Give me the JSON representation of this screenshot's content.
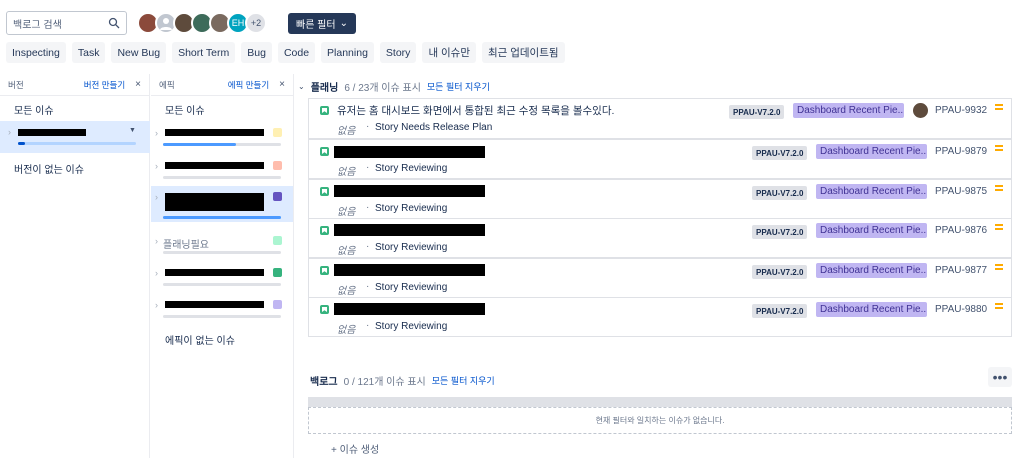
{
  "search": {
    "placeholder": "백로그 검색"
  },
  "avatars": {
    "initials": "EH",
    "overflow": "+2"
  },
  "quick_filter": {
    "label": "빠른 필터"
  },
  "filter_chips": [
    "Inspecting",
    "Task",
    "New Bug",
    "Short Term",
    "Bug",
    "Code",
    "Planning",
    "Story",
    "내 이슈만",
    "최근 업데이트됨"
  ],
  "versions": {
    "title": "버전",
    "create": "버전 만들기",
    "close": "×",
    "all": "모든 이슈",
    "no_version": "버전이 없는 이슈"
  },
  "epics": {
    "title": "에픽",
    "create": "에픽 만들기",
    "close": "×",
    "all": "모든 이슈",
    "planning_needed": "플래닝필요",
    "no_epic": "에픽이 없는 이슈",
    "colors": [
      "#fff0b3",
      "#ffbdad",
      "#6554c0",
      "#abf5d1",
      "#36b37e",
      "#c0b6f2"
    ]
  },
  "sprint": {
    "name": "플래닝",
    "count": "6 / 23개 이슈 표시",
    "clear": "모든 필터 지우기",
    "issues": [
      {
        "title": "유저는 홈 대시보드 화면에서 통합된 최근 수정 목록을 볼수있다.",
        "none": "없음",
        "status": "Story Needs Release Plan",
        "version": "PPAU-V7.2.0",
        "epic": "Dashboard Recent Pie...",
        "key": "PPAU-9932"
      },
      {
        "title": "",
        "none": "없음",
        "status": "Story Reviewing",
        "version": "PPAU-V7.2.0",
        "epic": "Dashboard Recent Pie...",
        "key": "PPAU-9879"
      },
      {
        "title": "",
        "none": "없음",
        "status": "Story Reviewing",
        "version": "PPAU-V7.2.0",
        "epic": "Dashboard Recent Pie...",
        "key": "PPAU-9875"
      },
      {
        "title": "",
        "none": "없음",
        "status": "Story Reviewing",
        "version": "PPAU-V7.2.0",
        "epic": "Dashboard Recent Pie...",
        "key": "PPAU-9876"
      },
      {
        "title": "",
        "none": "없음",
        "status": "Story Reviewing",
        "version": "PPAU-V7.2.0",
        "epic": "Dashboard Recent Pie...",
        "key": "PPAU-9877"
      },
      {
        "title": "",
        "none": "없음",
        "status": "Story Reviewing",
        "version": "PPAU-V7.2.0",
        "epic": "Dashboard Recent Pie...",
        "key": "PPAU-9880"
      }
    ]
  },
  "backlog": {
    "name": "백로그",
    "count": "0 / 121개 이슈 표시",
    "clear": "모든 필터 지우기",
    "more": "•••",
    "empty": "현재 필터와 일치하는 이슈가 없습니다.",
    "create": "+ 이슈 생성"
  },
  "colors": {
    "accent": "#0052cc",
    "dark_button": "#253858",
    "epic_lozenge": "#c0b6f2",
    "story_icon": "#36b37e",
    "priority": "#ffab00"
  }
}
